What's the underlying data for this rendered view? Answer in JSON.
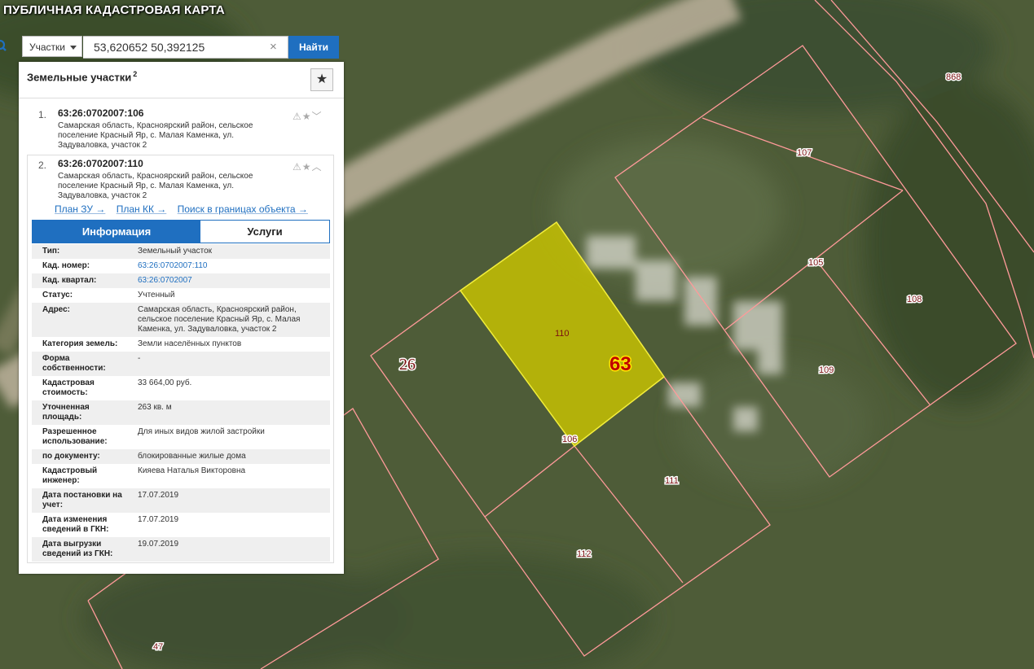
{
  "app": {
    "title": "ПУБЛИЧНАЯ КАДАСТРОВАЯ КАРТА"
  },
  "search": {
    "type_selected": "Участки",
    "query": "53,620652 50,392125",
    "clear_symbol": "×",
    "button_label": "Найти"
  },
  "panel": {
    "title": "Земельные участки",
    "count": "2",
    "favorite_symbol": "★",
    "results": [
      {
        "num": "1.",
        "cad_number": "63:26:0702007:106",
        "address": "Самарская область, Красноярский район, сельское поселение Красный Яр, с. Малая Каменка, ул. Задуваловка, участок 2",
        "icons": "⚠★﹀"
      },
      {
        "num": "2.",
        "cad_number": "63:26:0702007:110",
        "address": "Самарская область, Красноярский район, сельское поселение Красный Яр, с. Малая Каменка, ул. Задуваловка, участок 2",
        "icons": "⚠★︿"
      }
    ],
    "links": [
      "План ЗУ →",
      "План КК →",
      "Поиск в границах объекта →"
    ],
    "tabs": {
      "info": "Информация",
      "services": "Услуги"
    },
    "info": [
      {
        "k": "Тип:",
        "v": "Земельный участок"
      },
      {
        "k": "Кад. номер:",
        "v": "63:26:0702007:110"
      },
      {
        "k": "Кад. квартал:",
        "v": "63:26:0702007"
      },
      {
        "k": "Статус:",
        "v": "Учтенный"
      },
      {
        "k": "Адрес:",
        "v": "Самарская область, Красноярский район, сельское поселение Красный Яр, с. Малая Каменка, ул. Задуваловка, участок 2"
      },
      {
        "k": "Категория земель:",
        "v": "Земли населённых пунктов"
      },
      {
        "k": "Форма собственности:",
        "v": "-"
      },
      {
        "k": "Кадастровая стоимость:",
        "v": "33 664,00 руб."
      },
      {
        "k": "Уточненная площадь:",
        "v": "263 кв. м"
      },
      {
        "k": "Разрешенное использование:",
        "v": "Для иных видов жилой застройки"
      },
      {
        "k": "по документу:",
        "v": "блокированные жилые дома"
      },
      {
        "k": "Кадастровый инженер:",
        "v": "Кияева Наталья Викторовна"
      },
      {
        "k": "Дата постановки на учет:",
        "v": "17.07.2019"
      },
      {
        "k": "Дата изменения сведений в ГКН:",
        "v": "17.07.2019"
      },
      {
        "k": "Дата выгрузки сведений из ГКН:",
        "v": "19.07.2019"
      }
    ]
  },
  "map": {
    "selected_color": "#c9c400",
    "boundary_color": "#ff9a9a",
    "labels": {
      "p868": "868",
      "p107": "107",
      "p105": "105",
      "p108": "108",
      "p109": "109",
      "p110": "110",
      "p106": "106",
      "p111": "111",
      "p112": "112",
      "p47": "47",
      "q26": "26",
      "q63": "63"
    }
  }
}
